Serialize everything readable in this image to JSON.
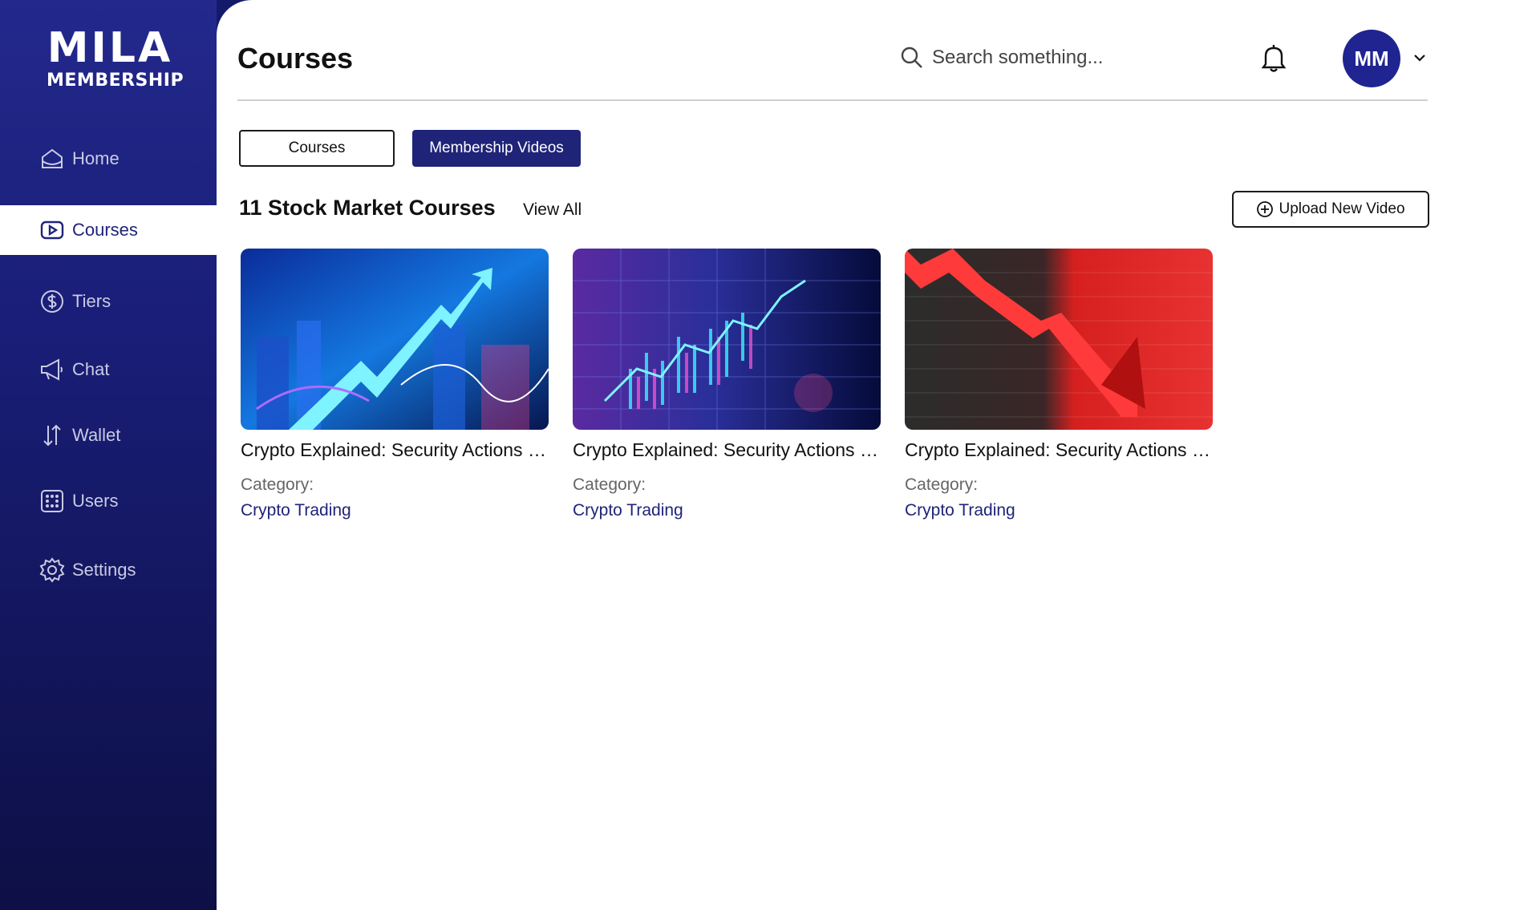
{
  "brand": {
    "line1": "MILA",
    "line2": "MEMBERSHIP"
  },
  "sidebar": {
    "items": [
      {
        "label": "Home",
        "icon": "home-icon"
      },
      {
        "label": "Courses",
        "icon": "play-icon",
        "active": true
      },
      {
        "label": "Tiers",
        "icon": "dollar-icon"
      },
      {
        "label": "Chat",
        "icon": "megaphone-icon"
      },
      {
        "label": "Wallet",
        "icon": "arrows-up-down-icon"
      },
      {
        "label": "Users",
        "icon": "grid-icon"
      },
      {
        "label": "Settings",
        "icon": "gear-icon"
      }
    ]
  },
  "header": {
    "title": "Courses",
    "search_placeholder": "Search something...",
    "avatar_initials": "MM"
  },
  "tabs": [
    {
      "label": "Courses",
      "selected": false
    },
    {
      "label": "Membership Videos",
      "selected": true
    }
  ],
  "section": {
    "title": "11 Stock Market Courses",
    "view_all": "View All",
    "upload_label": "Upload New Video"
  },
  "cards": [
    {
      "title": "Crypto Explained: Security Actions and Trading Strategies",
      "category_label": "Category:",
      "category": "Crypto Trading"
    },
    {
      "title": "Crypto Explained: Security Actions and Trading Strategies",
      "category_label": "Category:",
      "category": "Crypto Trading"
    },
    {
      "title": "Crypto Explained: Security Actions and Trading Strategies",
      "category_label": "Category:",
      "category": "Crypto Trading"
    }
  ],
  "colors": {
    "sidebar_top": "#23298c",
    "sidebar_bottom": "#0d0f45",
    "accent": "#1f2478",
    "avatar": "#1f2490"
  }
}
